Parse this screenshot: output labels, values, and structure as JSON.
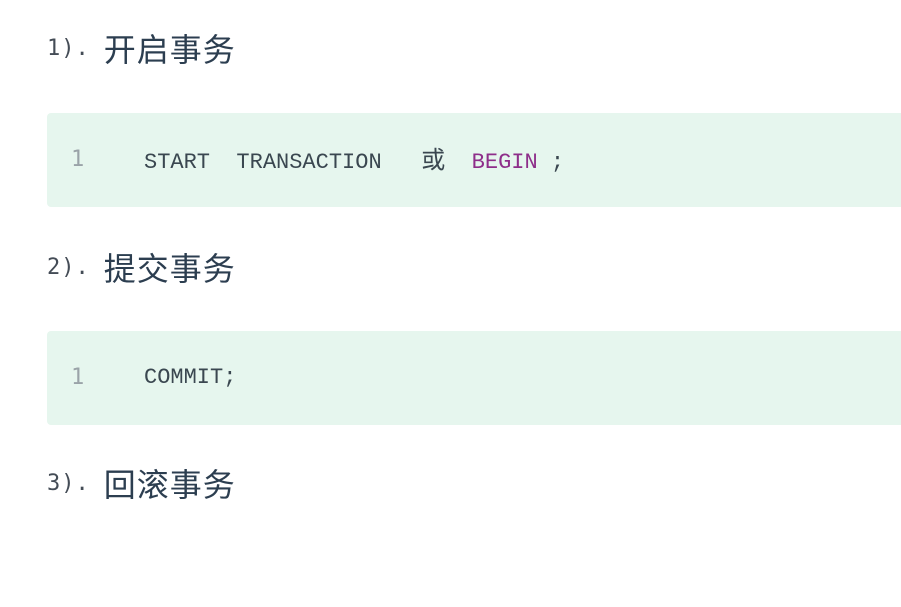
{
  "sections": [
    {
      "number": "1).",
      "title": "开启事务",
      "code": {
        "line_number": "1",
        "tokens": [
          "START",
          "TRANSACTION",
          "或",
          "BEGIN",
          ";"
        ]
      }
    },
    {
      "number": "2).",
      "title": "提交事务",
      "code": {
        "line_number": "1",
        "tokens": [
          "COMMIT;"
        ]
      }
    },
    {
      "number": "3).",
      "title": "回滚事务"
    }
  ],
  "colors": {
    "code_background": "#e6f6ee",
    "keyword_purple": "#8e2e8a",
    "heading_text": "#2c3e50",
    "line_number": "#9aa3a8"
  }
}
